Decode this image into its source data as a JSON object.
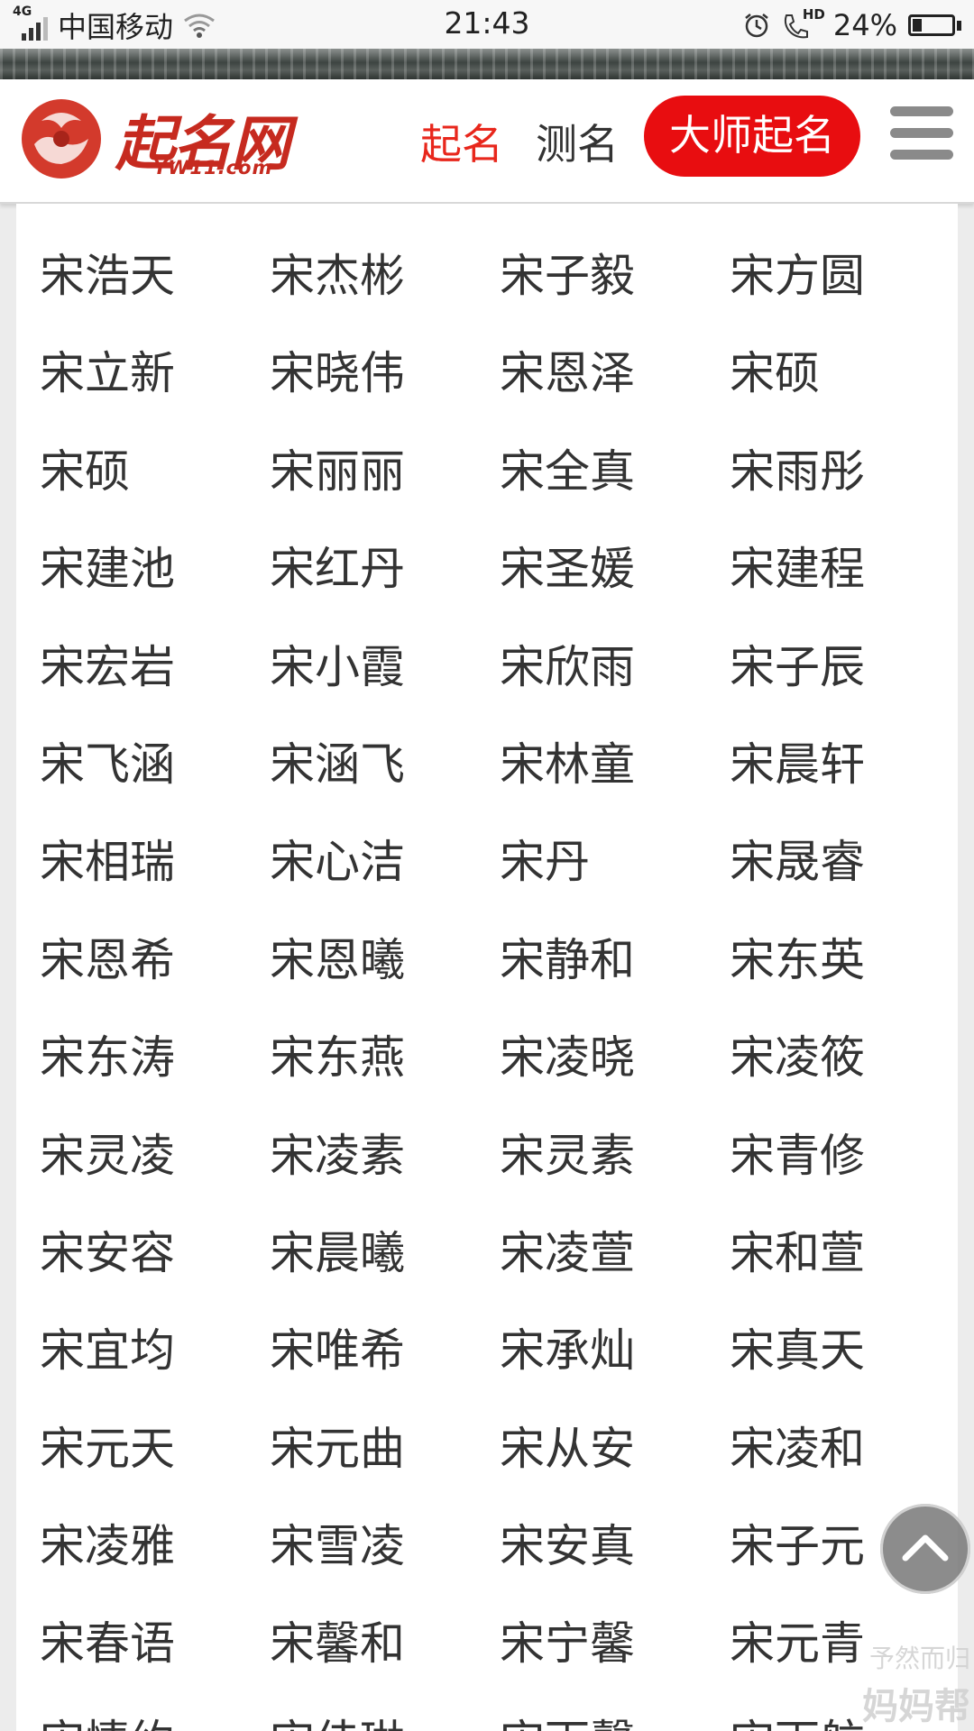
{
  "status_bar": {
    "network": "4G",
    "carrier": "中国移动",
    "time": "21:43",
    "hd_label": "HD",
    "battery": "24%",
    "battery_level": 0.24
  },
  "header": {
    "logo_name": "起名网",
    "logo_url": "YW11.com",
    "nav": {
      "qiming": "起名",
      "ceming": "测名",
      "master": "大师起名"
    }
  },
  "names": [
    [
      "宋浩天",
      "宋杰彬",
      "宋子毅",
      "宋方圆"
    ],
    [
      "宋立新",
      "宋晓伟",
      "宋恩泽",
      "宋硕"
    ],
    [
      "宋硕",
      "宋丽丽",
      "宋全真",
      "宋雨彤"
    ],
    [
      "宋建池",
      "宋红丹",
      "宋圣媛",
      "宋建程"
    ],
    [
      "宋宏岩",
      "宋小霞",
      "宋欣雨",
      "宋子辰"
    ],
    [
      "宋飞涵",
      "宋涵飞",
      "宋林童",
      "宋晨轩"
    ],
    [
      "宋相瑞",
      "宋心洁",
      "宋丹",
      "宋晟睿"
    ],
    [
      "宋恩希",
      "宋恩曦",
      "宋静和",
      "宋东英"
    ],
    [
      "宋东涛",
      "宋东燕",
      "宋凌晓",
      "宋凌筱"
    ],
    [
      "宋灵凌",
      "宋凌素",
      "宋灵素",
      "宋青修"
    ],
    [
      "宋安容",
      "宋晨曦",
      "宋凌萱",
      "宋和萱"
    ],
    [
      "宋宜均",
      "宋唯希",
      "宋承灿",
      "宋真天"
    ],
    [
      "宋元天",
      "宋元曲",
      "宋从安",
      "宋凌和"
    ],
    [
      "宋凌雅",
      "宋雪凌",
      "宋安真",
      "宋子元"
    ],
    [
      "宋春语",
      "宋馨和",
      "宋宁馨",
      "宋元青"
    ],
    [
      "宋情约",
      "宋佳琳",
      "宋雨馨",
      "宋雨航"
    ]
  ],
  "watermark": {
    "line1": "予然而归",
    "line2": "妈妈帮"
  },
  "colors": {
    "accent_red": "#e80d10",
    "nav_red": "#e8271c",
    "text": "#333333"
  }
}
